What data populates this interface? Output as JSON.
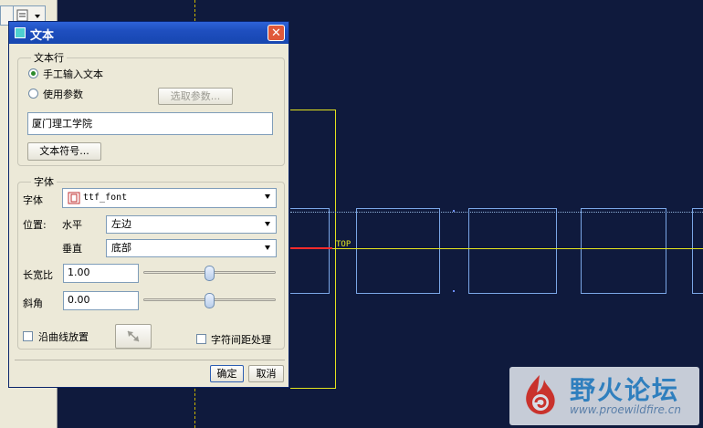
{
  "canvas": {
    "top_label": "TOP",
    "watermark_title": "野火论坛",
    "watermark_url": "www.proewildfire.cn"
  },
  "dialog": {
    "title": "文本",
    "close_symbol": "✕",
    "text_line_group": "文本行",
    "radio_manual": "手工输入文本",
    "radio_manual_checked": true,
    "radio_param": "使用参数",
    "select_param_button": "选取参数...",
    "text_value": "厦门理工学院",
    "text_symbol_button": "文本符号...",
    "font_group": "字体",
    "font_label": "字体",
    "font_value": "ttf_font",
    "position_label": "位置:",
    "horizontal_label": "水平",
    "horizontal_value": "左边",
    "vertical_label": "垂直",
    "vertical_value": "底部",
    "aspect_label": "长宽比",
    "aspect_value": "1.00",
    "aspect_slider_level": 0.5,
    "slant_label": "斜角",
    "slant_value": "0.00",
    "slant_slider_level": 0.5,
    "along_curve_label": "沿曲线放置",
    "kerning_label": "字符间距处理",
    "ok_button": "确定",
    "cancel_button": "取消"
  }
}
